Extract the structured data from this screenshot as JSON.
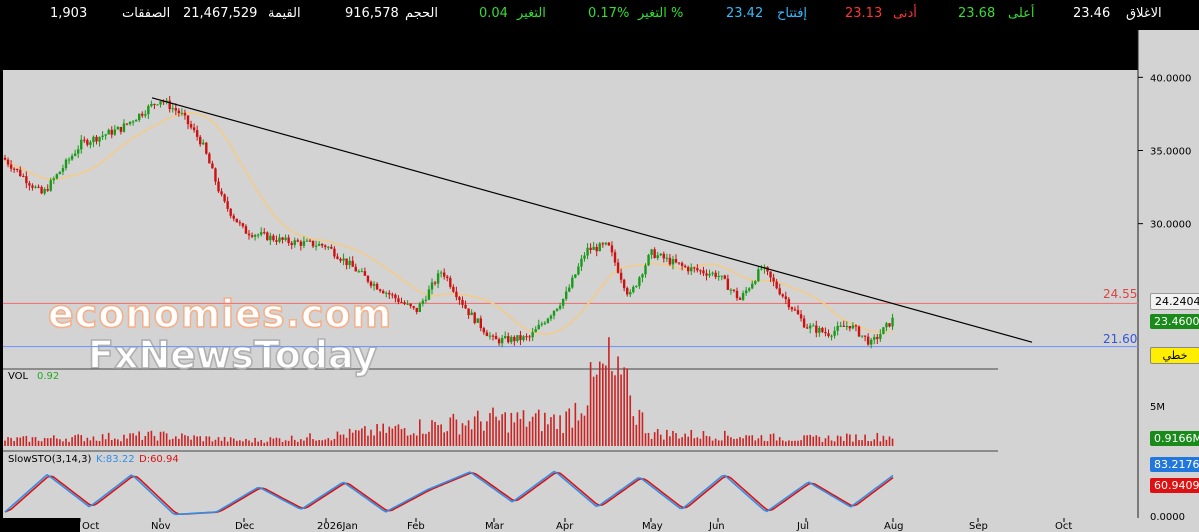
{
  "header": {
    "close_label": "الاغلاق",
    "close_value": "23.46",
    "high_label": "أعلى",
    "high_value": "23.68",
    "low_label": "أدنى",
    "low_value": "23.13",
    "open_label": "إفتتاح",
    "open_value": "23.42",
    "change_pct_label": "التغير %",
    "change_pct_value": "0.17%",
    "change_label": "التغير",
    "change_value": "0.04",
    "volume_label": "الحجم",
    "volume_value": "916,578",
    "value_label": "القيمة",
    "value_value": "21,467,529",
    "trades_label": "الصفقات",
    "trades_value": "1,903"
  },
  "watermark": {
    "line1": "economies.com",
    "line2": "FxNewsToday"
  },
  "price_panel": {
    "y_ticks": [
      "40.0000",
      "35.0000",
      "30.0000"
    ],
    "resistance_label": "24.55",
    "support_label": "21.60",
    "ma_tag": "24.2404",
    "price_tag": "23.4600",
    "linear_button": "خطي"
  },
  "volume_panel": {
    "title": "VOL",
    "value": "0.92",
    "y_tick": "5M",
    "tag": "0.9166M"
  },
  "stoch_panel": {
    "title": "SlowSTO(3,14,3)",
    "k_text": "K:83.22",
    "d_text": "D:60.94",
    "k_tag": "83.2176",
    "d_tag": "60.9409",
    "zero_tick": "0.0000"
  },
  "colors": {
    "background": "#d3d3d3",
    "up_candle": "#1a9a1a",
    "down_candle": "#cc1111",
    "ma": "#f0cc90",
    "trendline": "#000000",
    "resistance": "#ee7777",
    "support": "#7799ff",
    "volume": "#cc2222",
    "k_line": "#2f8fe8",
    "d_line": "#dd1111"
  },
  "chart_data": {
    "type": "candlestick",
    "x_axis_labels": [
      "Oct",
      "Nov",
      "Dec",
      "2026Jan",
      "Feb",
      "Mar",
      "Apr",
      "May",
      "Jun",
      "Jul",
      "Aug",
      "Sep",
      "Oct"
    ],
    "y_range": [
      20.0,
      40.5
    ],
    "y_ticks": [
      40,
      35,
      30
    ],
    "horizontal_lines": [
      {
        "label": "24.55",
        "value": 24.55
      },
      {
        "label": "21.60",
        "value": 21.6
      }
    ],
    "trendline": {
      "from": {
        "month": "Nov",
        "price": 38.6
      },
      "to": {
        "month": "Aug",
        "price": 21.9
      }
    },
    "moving_average_last": 24.2404,
    "last_close": 23.46,
    "price_anchors": [
      [
        "Oct",
        34.5
      ],
      [
        "Oct",
        32.0
      ],
      [
        "Oct",
        35.5
      ],
      [
        "Oct",
        36.5
      ],
      [
        "Nov",
        38.5
      ],
      [
        "Nov",
        37.5
      ],
      [
        "Nov",
        35.5
      ],
      [
        "Nov",
        31.5
      ],
      [
        "Dec",
        29.5
      ],
      [
        "Dec",
        28.8
      ],
      [
        "2026Jan",
        28.5
      ],
      [
        "2026Jan",
        26.0
      ],
      [
        "Feb",
        24.0
      ],
      [
        "Feb",
        26.8
      ],
      [
        "Feb",
        24.0
      ],
      [
        "Mar",
        22.0
      ],
      [
        "Mar",
        22.2
      ],
      [
        "Apr",
        25.0
      ],
      [
        "Apr",
        28.2
      ],
      [
        "Apr",
        28.5
      ],
      [
        "Apr",
        25.0
      ],
      [
        "May",
        28.0
      ],
      [
        "May",
        27.0
      ],
      [
        "Jun",
        26.5
      ],
      [
        "Jun",
        24.8
      ],
      [
        "Jun",
        27.0
      ],
      [
        "Jun",
        25.0
      ],
      [
        "Jul",
        23.0
      ],
      [
        "Jul",
        22.5
      ],
      [
        "Jul",
        23.1
      ],
      [
        "Jul",
        21.8
      ],
      [
        "Aug",
        23.46
      ]
    ],
    "volume_unit": "M",
    "volume_anchors": [
      [
        "Oct",
        0.6
      ],
      [
        "Nov",
        1.0
      ],
      [
        "Dec",
        0.5
      ],
      [
        "2026Jan",
        0.9
      ],
      [
        "Feb",
        1.8
      ],
      [
        "Mar",
        2.5
      ],
      [
        "Apr",
        2.4
      ],
      [
        "Apr",
        7.4
      ],
      [
        "May",
        1.2
      ],
      [
        "Jun",
        1.0
      ],
      [
        "Jul",
        0.7
      ],
      [
        "Aug",
        0.92
      ]
    ],
    "stochastic": {
      "k_last": 83.2176,
      "d_last": 60.9409,
      "k_anchors": [
        10,
        85,
        20,
        85,
        5,
        10,
        60,
        15,
        70,
        10,
        55,
        90,
        30,
        92,
        20,
        80,
        15,
        85,
        10,
        70,
        20,
        83.22
      ]
    }
  }
}
